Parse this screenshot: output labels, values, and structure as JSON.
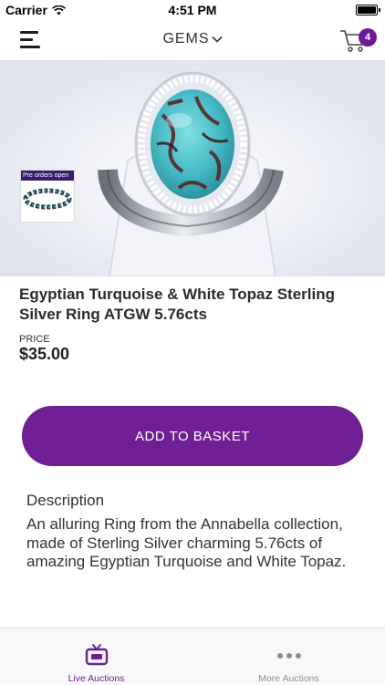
{
  "status_bar": {
    "carrier": "Carrier",
    "time": "4:51 PM"
  },
  "nav": {
    "title": "GEMS",
    "cart_count": "4",
    "icons": [
      "hamburger-menu-icon",
      "chevron-down-icon",
      "shopping-cart-icon"
    ]
  },
  "product": {
    "thumbnail_tag": "Pre orders open",
    "title": "Egyptian Turquoise & White Topaz Sterling Silver Ring ATGW 5.76cts",
    "price_label": "PRICE",
    "price": "$35.00",
    "add_button_label": "ADD TO BASKET"
  },
  "description": {
    "heading": "Description",
    "body": "An alluring Ring from the Annabella collection, made of Sterling Silver charming 5.76cts of amazing Egyptian Turquoise and White Topaz."
  },
  "tab_bar": {
    "tabs": [
      {
        "label": "Live Auctions",
        "icon": "tv-icon",
        "active": true
      },
      {
        "label": "More Auctions",
        "icon": "more-dots-icon",
        "active": false
      }
    ]
  },
  "colors": {
    "accent": "#6f1f93",
    "badge": "#6a1b9a"
  }
}
